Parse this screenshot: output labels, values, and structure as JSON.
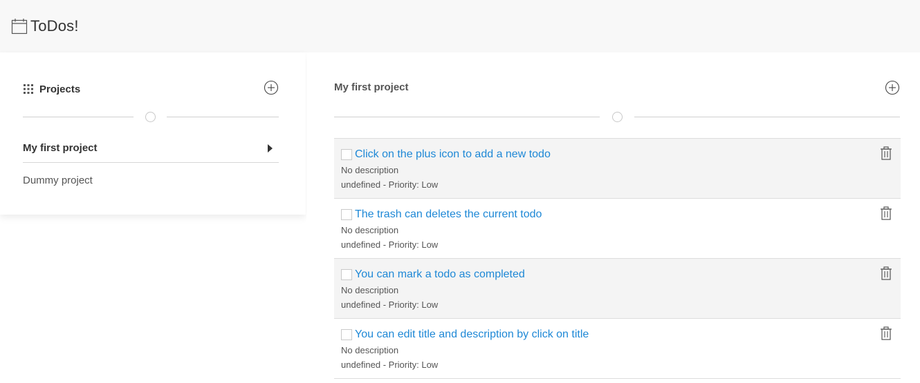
{
  "header": {
    "title": "ToDos!",
    "icon": "calendar-icon"
  },
  "sidebar": {
    "title": "Projects",
    "projects": [
      {
        "label": "My first project",
        "active": true
      },
      {
        "label": "Dummy project",
        "active": false
      }
    ]
  },
  "main": {
    "project_title": "My first project",
    "todos": [
      {
        "title": "Click on the plus icon to add a new todo",
        "description": "No description",
        "meta": "undefined - Priority: Low",
        "completed": false
      },
      {
        "title": "The trash can deletes the current todo",
        "description": "No description",
        "meta": "undefined - Priority: Low",
        "completed": false
      },
      {
        "title": "You can mark a todo as completed",
        "description": "No description",
        "meta": "undefined - Priority: Low",
        "completed": false
      },
      {
        "title": "You can edit title and description by click on title",
        "description": "No description",
        "meta": "undefined - Priority: Low",
        "completed": false
      }
    ]
  },
  "colors": {
    "header_bg": "#f8f8f8",
    "link": "#1e88d6",
    "row_shade": "#f4f4f4",
    "divider": "#cfcfcf"
  }
}
